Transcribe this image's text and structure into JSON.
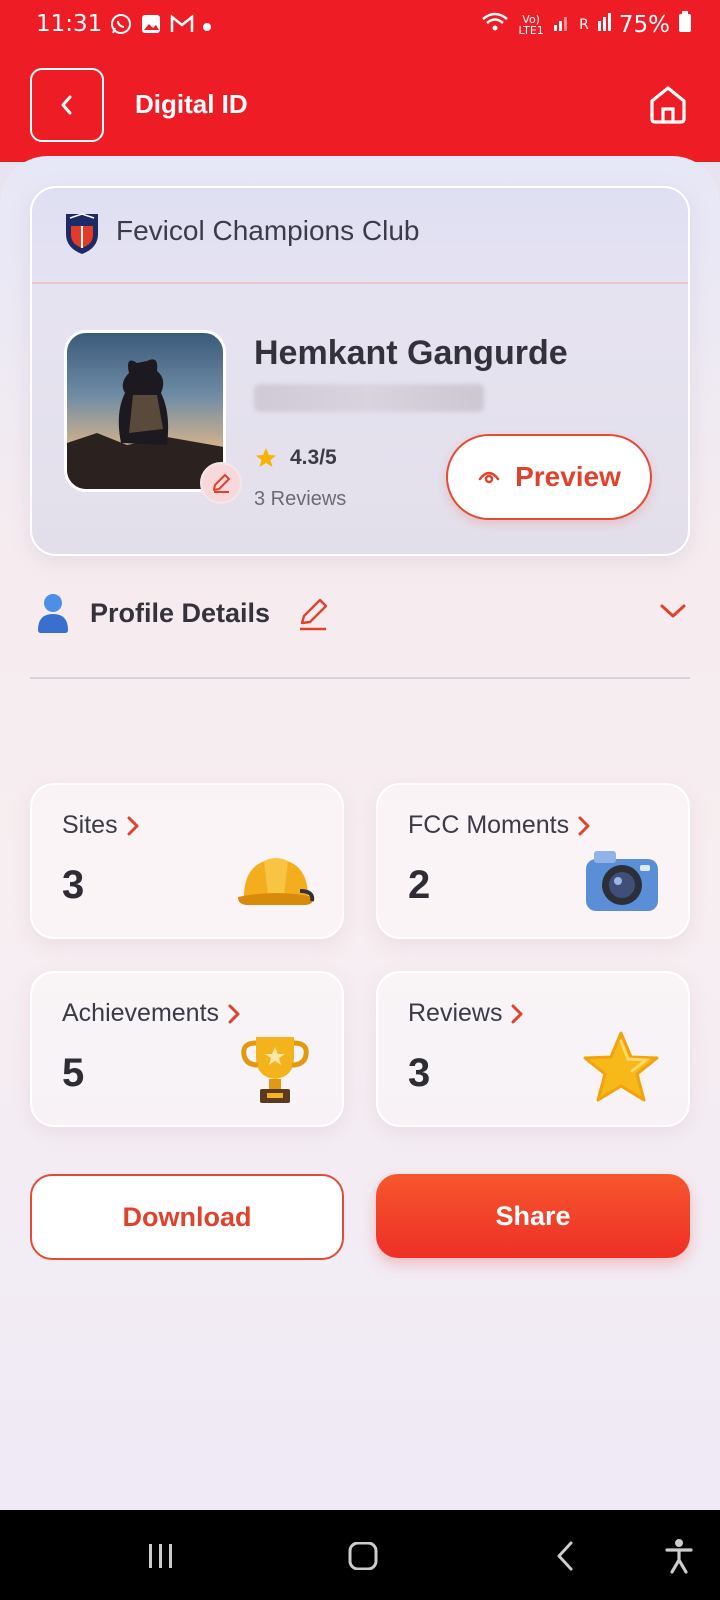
{
  "status_bar": {
    "time": "11:31",
    "battery": "75%",
    "network": "Vo) LTE1",
    "sim": "R"
  },
  "header": {
    "title": "Digital ID"
  },
  "card": {
    "club_name": "Fevicol Champions Club",
    "name": "Hemkant Gangurde",
    "rating": "4.3/5",
    "reviews_count": "3 Reviews",
    "preview_label": "Preview"
  },
  "profile_details": {
    "title": "Profile Details"
  },
  "stats": [
    {
      "label": "Sites",
      "value": "3",
      "icon": "hard-hat-icon"
    },
    {
      "label": "FCC Moments",
      "value": "2",
      "icon": "camera-icon"
    },
    {
      "label": "Achievements",
      "value": "5",
      "icon": "trophy-icon"
    },
    {
      "label": "Reviews",
      "value": "3",
      "icon": "star-icon"
    }
  ],
  "actions": {
    "download_label": "Download",
    "share_label": "Share"
  },
  "colors": {
    "brand_red": "#ee1c25",
    "accent_orange": "#e0432d"
  }
}
